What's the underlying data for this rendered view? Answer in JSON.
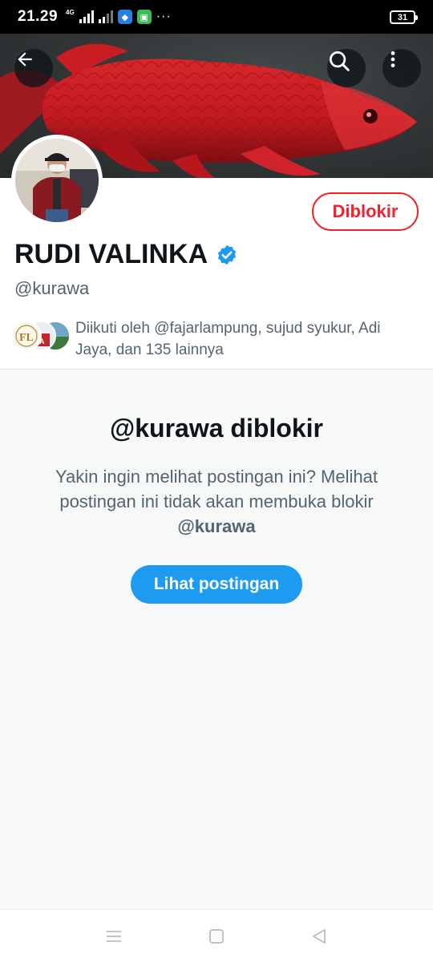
{
  "status_bar": {
    "time": "21.29",
    "network": "4G",
    "battery": "31",
    "more": "···"
  },
  "header": {
    "back_icon": "arrow-left-icon",
    "search_icon": "search-icon",
    "more_icon": "more-vertical-icon"
  },
  "profile": {
    "display_name": "RUDI VALINKA",
    "verified": true,
    "handle": "@kurawa",
    "block_button_label": "Diblokir",
    "followed_by_text": "Diikuti oleh @fajarlampung, sujud syukur, Adi Jaya, dan 135 lainnya"
  },
  "blocked": {
    "title": "@kurawa diblokir",
    "description": "Yakin ingin melihat postingan ini? Melihat postingan ini tidak akan membuka blokir",
    "description_handle": "@kurawa",
    "view_button_label": "Lihat postingan"
  },
  "colors": {
    "accent_blue": "#1d9bf0",
    "block_red": "#f4212e",
    "text_primary": "#0f1419",
    "text_secondary": "#536471"
  }
}
